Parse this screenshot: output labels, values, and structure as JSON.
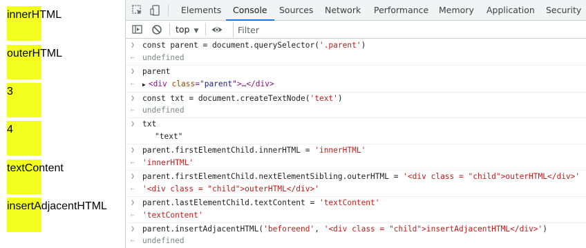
{
  "page": {
    "children": [
      "innerHTML",
      "outerHTML",
      "3",
      "4",
      "textContent",
      "insertAdjacentHTML"
    ]
  },
  "devtools": {
    "tabs": [
      "Elements",
      "Console",
      "Sources",
      "Network",
      "Performance",
      "Memory",
      "Application",
      "Security"
    ],
    "active_tab": "Console",
    "context": "top",
    "filter_placeholder": "Filter"
  },
  "console": {
    "l1_in_a": "const parent = document.querySelector(",
    "l1_in_s": "'.parent'",
    "l1_in_b": ")",
    "l1_out": "undefined",
    "l2_in": "parent",
    "l2_out_open": "<div",
    "l2_out_attr": "class",
    "l2_out_eq": "=\"",
    "l2_out_val": "parent",
    "l2_out_close": "\">…</div>",
    "l3_in_a": "const txt = document.createTextNode(",
    "l3_in_s": "'text'",
    "l3_in_b": ")",
    "l3_out": "undefined",
    "l4_in": "txt",
    "l4_out": "\"text\"",
    "l5_in_a": "parent.firstElementChild.innerHTML = ",
    "l5_in_s": "'innerHTML'",
    "l5_out": "'innerHTML'",
    "l6_in_a": "parent.firstElementChild.nextElementSibling.outerHTML = ",
    "l6_in_s": "'<div class = \"child\">outerHTML</div>'",
    "l6_out": "'<div class = \"child\">outerHTML</div>'",
    "l7_in_a": "parent.lastElementChild.textContent = ",
    "l7_in_s": "'textContent'",
    "l7_out": "'textContent'",
    "l8_in_a": "parent.insertAdjacentHTML(",
    "l8_in_s1": "'beforeend'",
    "l8_in_c": ", ",
    "l8_in_s2": "'<div class = \"child\">insertAdjacentHTML</div>'",
    "l8_in_b": ")",
    "l8_out": "undefined"
  },
  "icons": [
    "inspect-element-icon",
    "device-toolbar-icon",
    "sidebar-toggle-icon",
    "clear-console-icon",
    "eye-icon",
    "input-prompt-icon",
    "result-arrow-icon",
    "expand-triangle-icon"
  ],
  "colors": {
    "child_bg": "#f3ff1f",
    "active_tab_underline": "#1a73e8",
    "string": "#c41a16",
    "tag": "#881280"
  }
}
